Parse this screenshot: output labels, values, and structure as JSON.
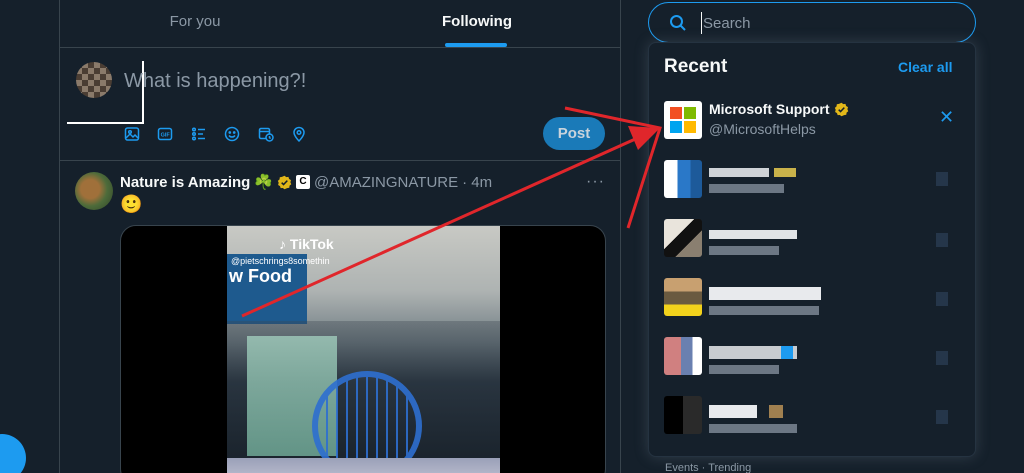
{
  "tabs": [
    {
      "label": "For you",
      "active": false
    },
    {
      "label": "Following",
      "active": true
    }
  ],
  "composer": {
    "placeholder": "What is happening?!",
    "post_label": "Post",
    "tools": [
      "image-icon",
      "gif-icon",
      "poll-icon",
      "emoji-icon",
      "schedule-icon",
      "location-icon"
    ]
  },
  "tweet": {
    "name": "Nature is Amazing",
    "name_emoji": "☘️",
    "badge_letter": "C",
    "handle": "@AMAZINGNATURE",
    "time": "· 4m",
    "body_emoji": "🙂",
    "more": "···",
    "video": {
      "tiktok_label": "TikTok",
      "tiktok_handle": "@pietschrings8somethin",
      "sign_text": "w Food"
    }
  },
  "search": {
    "placeholder": "Search",
    "recent_title": "Recent",
    "clear_all": "Clear all",
    "items": [
      {
        "name": "Microsoft Support",
        "handle": "@MicrosoftHelps",
        "verified": true
      }
    ]
  },
  "trending_label": "Events · Trending",
  "colors": {
    "background": "#15202b",
    "accent": "#1d9bf0",
    "verified_gold": "#e2b719",
    "annotation_red": "#e0262b",
    "ms_red": "#f25022",
    "ms_green": "#7fba00",
    "ms_blue": "#00a4ef",
    "ms_yellow": "#ffb900"
  }
}
